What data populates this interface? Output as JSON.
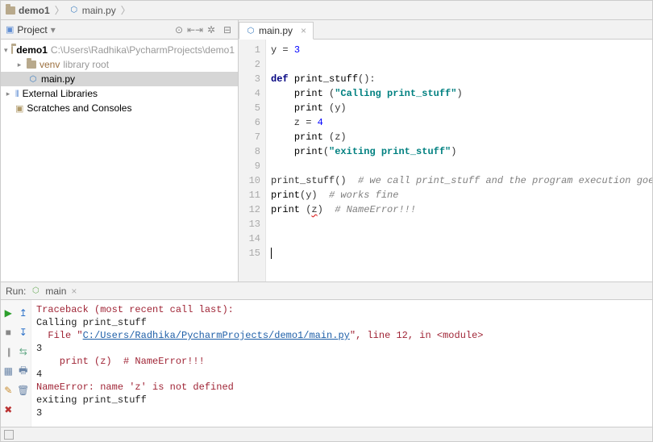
{
  "breadcrumb": {
    "project": "demo1",
    "file": "main.py"
  },
  "project_panel": {
    "title": "Project",
    "root_name": "demo1",
    "root_path": "C:\\Users\\Radhika\\PycharmProjects\\demo1",
    "venv_name": "venv",
    "venv_hint": "library root",
    "file": "main.py",
    "external_libs": "External Libraries",
    "scratches": "Scratches and Consoles"
  },
  "editor": {
    "tab_label": "main.py",
    "lines": [
      {
        "n": 1,
        "tokens": [
          {
            "t": "y = ",
            "c": ""
          },
          {
            "t": "3",
            "c": "num"
          }
        ]
      },
      {
        "n": 2,
        "tokens": []
      },
      {
        "n": 3,
        "tokens": [
          {
            "t": "def ",
            "c": "kw"
          },
          {
            "t": "print_stuff",
            "c": "fn"
          },
          {
            "t": "():",
            "c": ""
          }
        ]
      },
      {
        "n": 4,
        "tokens": [
          {
            "t": "    ",
            "c": ""
          },
          {
            "t": "print",
            "c": "call"
          },
          {
            "t": " (",
            "c": ""
          },
          {
            "t": "\"Calling print_stuff\"",
            "c": "str"
          },
          {
            "t": ")",
            "c": ""
          }
        ]
      },
      {
        "n": 5,
        "tokens": [
          {
            "t": "    ",
            "c": ""
          },
          {
            "t": "print",
            "c": "call"
          },
          {
            "t": " (y)",
            "c": ""
          }
        ]
      },
      {
        "n": 6,
        "tokens": [
          {
            "t": "    z = ",
            "c": ""
          },
          {
            "t": "4",
            "c": "num"
          }
        ]
      },
      {
        "n": 7,
        "tokens": [
          {
            "t": "    ",
            "c": ""
          },
          {
            "t": "print",
            "c": "call"
          },
          {
            "t": " (z)",
            "c": ""
          }
        ]
      },
      {
        "n": 8,
        "tokens": [
          {
            "t": "    ",
            "c": ""
          },
          {
            "t": "print",
            "c": "call"
          },
          {
            "t": "(",
            "c": ""
          },
          {
            "t": "\"exiting print_stuff\"",
            "c": "str"
          },
          {
            "t": ")",
            "c": ""
          }
        ]
      },
      {
        "n": 9,
        "tokens": []
      },
      {
        "n": 10,
        "tokens": [
          {
            "t": "print_stuff()  ",
            "c": ""
          },
          {
            "t": "# we call print_stuff and the program execution goes to (***)",
            "c": "com"
          }
        ]
      },
      {
        "n": 11,
        "tokens": [
          {
            "t": "print",
            "c": "call"
          },
          {
            "t": "(y)  ",
            "c": ""
          },
          {
            "t": "# works fine",
            "c": "com"
          }
        ]
      },
      {
        "n": 12,
        "tokens": [
          {
            "t": "print",
            "c": "call"
          },
          {
            "t": " (",
            "c": ""
          },
          {
            "t": "z",
            "c": "err-underline"
          },
          {
            "t": ")  ",
            "c": ""
          },
          {
            "t": "# NameError!!!",
            "c": "com"
          }
        ]
      },
      {
        "n": 13,
        "tokens": []
      },
      {
        "n": 14,
        "tokens": []
      },
      {
        "n": 15,
        "tokens": [],
        "current": true,
        "caret": true
      }
    ]
  },
  "run": {
    "label": "Run:",
    "config_name": "main",
    "output": [
      {
        "t": "Traceback (most recent call last):",
        "c": "tb"
      },
      {
        "t": "Calling print_stuff",
        "c": ""
      },
      {
        "segments": [
          {
            "t": "  File \"",
            "c": "tb"
          },
          {
            "t": "C:/Users/Radhika/PycharmProjects/demo1/main.py",
            "c": "link"
          },
          {
            "t": "\", line 12, in <module>",
            "c": "tb"
          }
        ]
      },
      {
        "t": "3",
        "c": ""
      },
      {
        "t": "    print (z)  # NameError!!!",
        "c": "tb"
      },
      {
        "t": "4",
        "c": ""
      },
      {
        "t": "NameError: name 'z' is not defined",
        "c": "tb"
      },
      {
        "t": "exiting print_stuff",
        "c": ""
      },
      {
        "t": "3",
        "c": ""
      }
    ]
  }
}
